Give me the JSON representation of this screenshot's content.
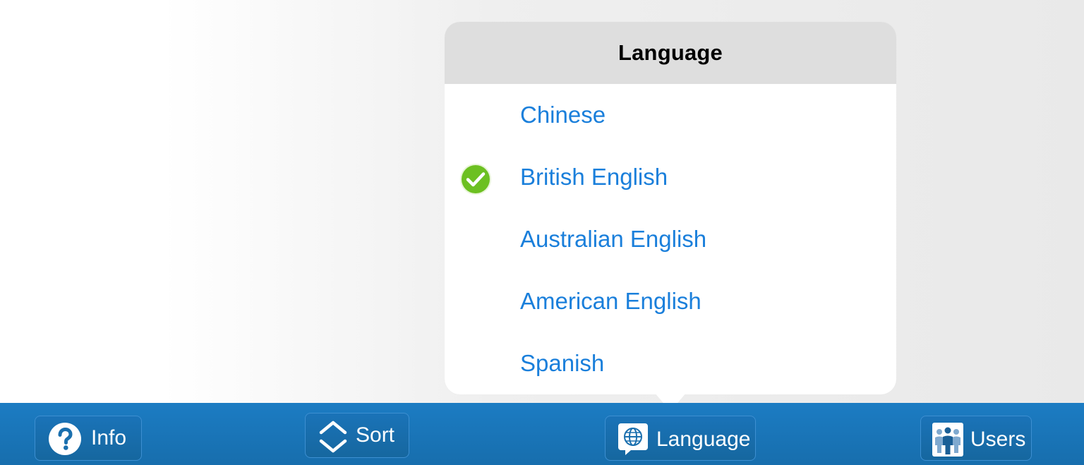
{
  "language_popover": {
    "title": "Language",
    "options": [
      {
        "label": "Chinese",
        "selected": false
      },
      {
        "label": "British English",
        "selected": true
      },
      {
        "label": "Australian English",
        "selected": false
      },
      {
        "label": "American English",
        "selected": false
      },
      {
        "label": "Spanish",
        "selected": false
      }
    ],
    "selected_icon": "green-checkmark-icon"
  },
  "toolbar": {
    "info_label": "Info",
    "info_icon": "question-circle-icon",
    "sort_label": "Sort",
    "sort_icon": "sort-chevrons-icon",
    "language_label": "Language",
    "language_icon": "globe-speech-bubble-icon",
    "users_label": "Users",
    "users_icon": "users-group-icon"
  },
  "colors": {
    "option_text": "#1a7fdb",
    "toolbar_background": "#1b75b9",
    "popover_header": "#dedede",
    "checkmark": "#6cc021"
  }
}
